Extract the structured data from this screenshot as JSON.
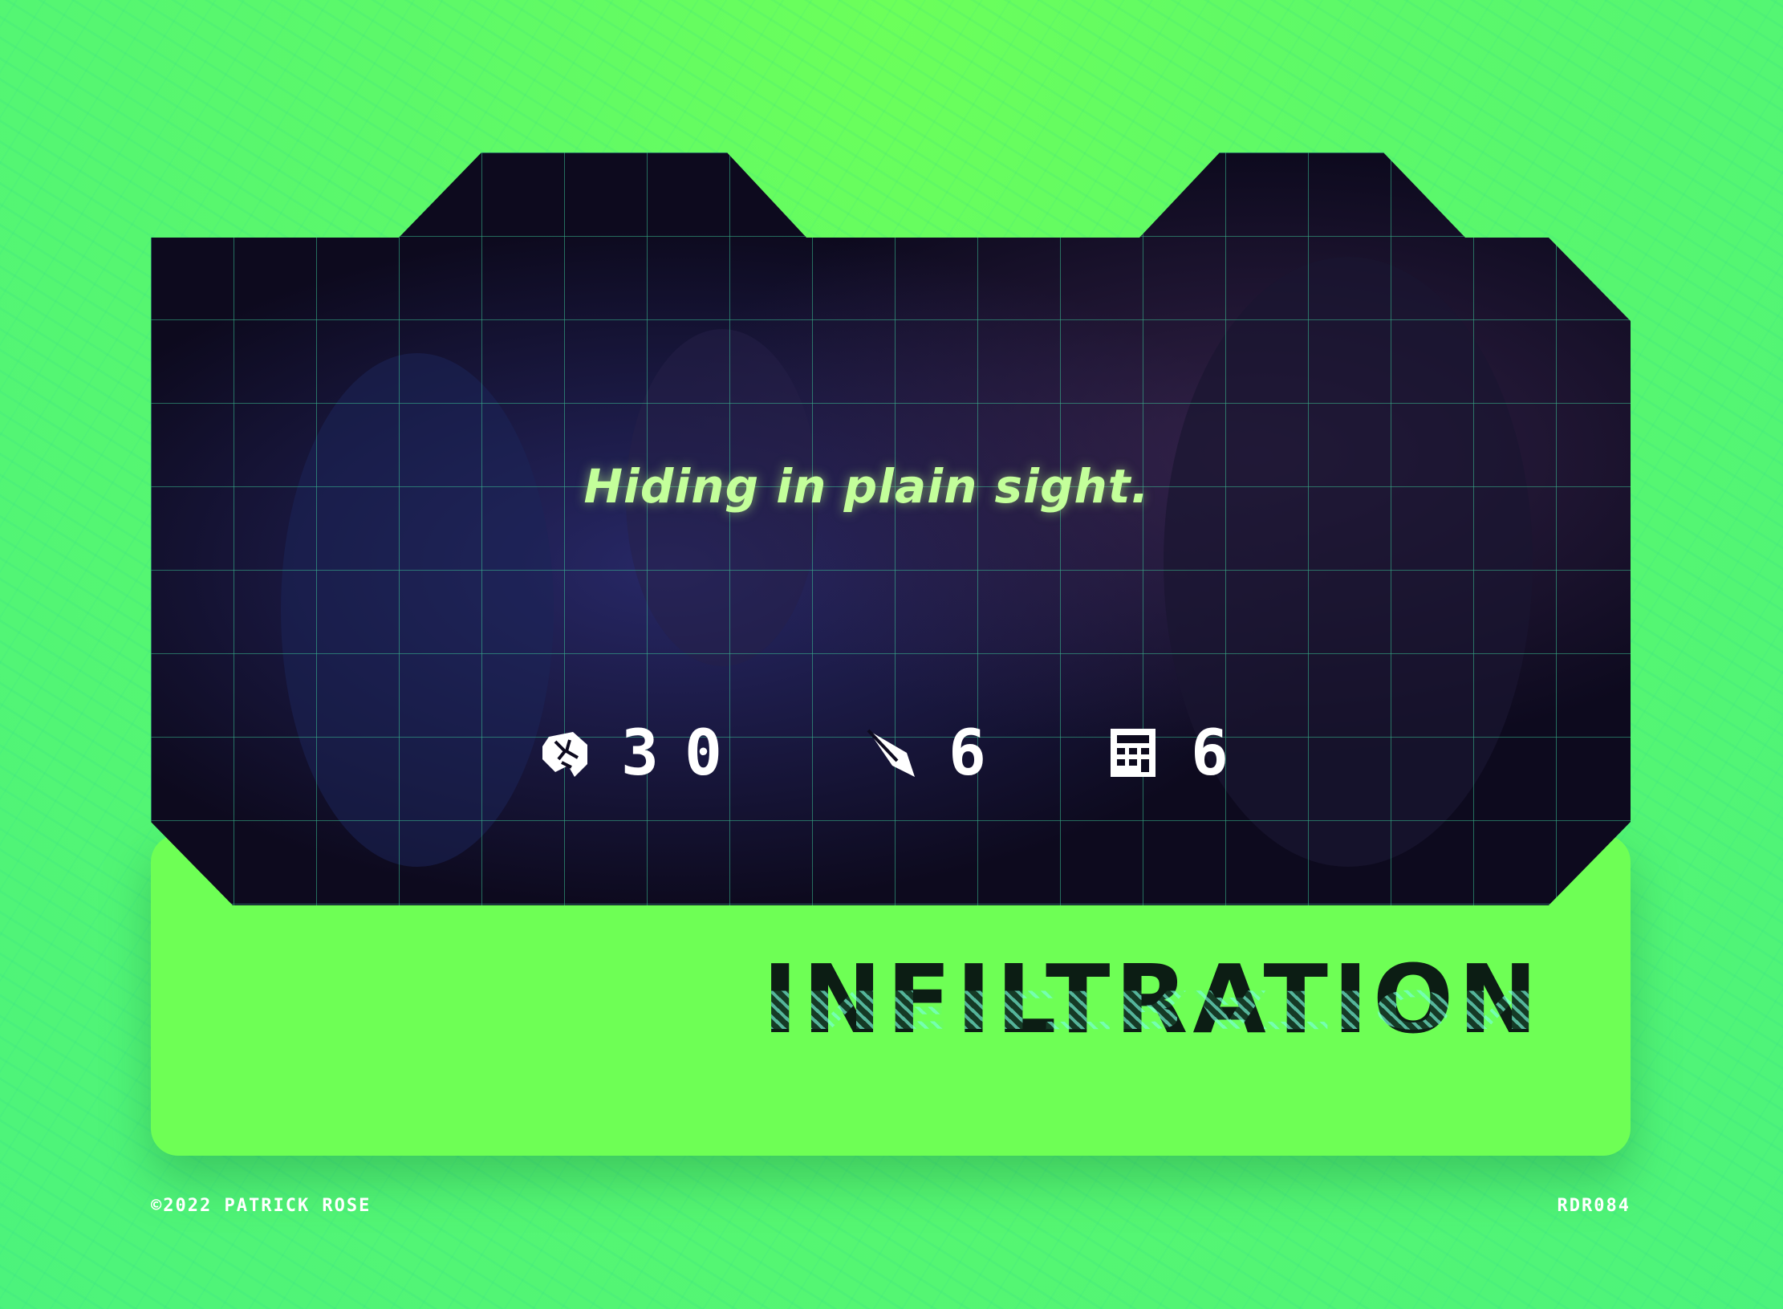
{
  "card": {
    "tagline": "Hiding in plain sight.",
    "title": "INFILTRATION",
    "stats": [
      {
        "icon": "brain-icon",
        "value": "30"
      },
      {
        "icon": "quill-icon",
        "value": "6"
      },
      {
        "icon": "calculator-icon",
        "value": "6"
      }
    ]
  },
  "footer": {
    "copyright": "©2022 PATRICK ROSE",
    "code": "RDR084"
  },
  "colors": {
    "background": "#56f76e",
    "panel": "#0d0a1e",
    "grid": "#3fd6a0",
    "title": "#0c1d14",
    "tagline": "#c3ff9a"
  }
}
